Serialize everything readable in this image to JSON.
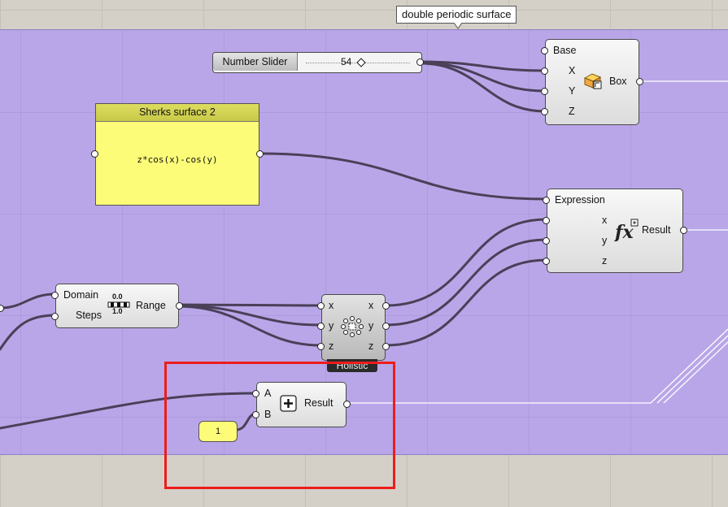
{
  "canvas": {
    "group_label": "double periodic surface"
  },
  "slider": {
    "name": "Number Slider",
    "value": "54"
  },
  "box_component": {
    "inputs": [
      "Base",
      "X",
      "Y",
      "Z"
    ],
    "output": "Box",
    "icon": "box-icon"
  },
  "panel": {
    "title": "Sherks surface 2",
    "content": "z*cos(x)-cos(y)"
  },
  "expression_component": {
    "inputs": [
      "Expression",
      "x",
      "y",
      "z"
    ],
    "output": "Result",
    "icon": "fx-icon"
  },
  "range_component": {
    "inputs": [
      "Domain",
      "Steps"
    ],
    "output": "Range",
    "icon_top": "0.0",
    "icon_bottom": "1.0"
  },
  "cluster_component": {
    "inputs": [
      "x",
      "y",
      "z"
    ],
    "outputs": [
      "x",
      "y",
      "z"
    ],
    "label": "Holistic",
    "icon": "cluster-icon"
  },
  "addition_component": {
    "inputs": [
      "A",
      "B"
    ],
    "output": "Result",
    "icon": "plus-icon"
  },
  "value_panel": {
    "value": "1"
  },
  "colors": {
    "group_fill": "#b9a6e8",
    "panel_fill": "#fcfc78",
    "highlight": "#ee1c1c",
    "wire": "#4a4058"
  }
}
